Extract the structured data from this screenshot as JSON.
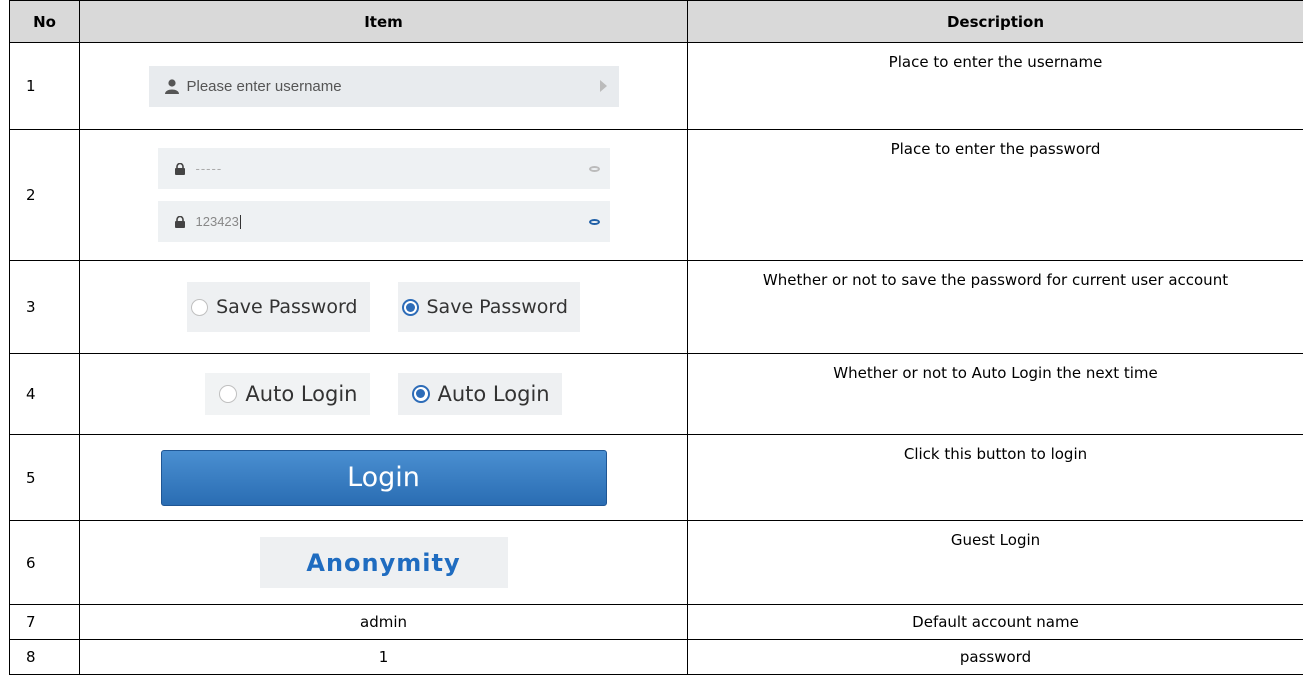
{
  "headers": {
    "no": "No",
    "item": "Item",
    "description": "Description"
  },
  "rows": [
    {
      "no": "1",
      "username_placeholder": "Please enter username",
      "description": "Place to enter the username"
    },
    {
      "no": "2",
      "password_masked": "-----",
      "password_plain": "123423",
      "description": "Place to enter the password"
    },
    {
      "no": "3",
      "label_unchecked": "Save Password",
      "label_checked": "Save Password",
      "description": "Whether or not to save the password for current user account"
    },
    {
      "no": "4",
      "label_unchecked": "Auto Login",
      "label_checked": "Auto Login",
      "description": "Whether or not to Auto Login the next time"
    },
    {
      "no": "5",
      "button_label": "Login",
      "description": "Click this button to login"
    },
    {
      "no": "6",
      "button_label": "Anonymity",
      "description": "Guest Login"
    },
    {
      "no": "7",
      "value": "admin",
      "description": "Default account name"
    },
    {
      "no": "8",
      "value": "1",
      "description": "password"
    }
  ],
  "icons": {
    "username": "user-icon",
    "password": "lock-icon",
    "reveal": "eye-icon",
    "submit": "arrow-right-icon"
  },
  "colors": {
    "header_bg": "#d9d9d9",
    "accent": "#2d6cb8",
    "login_button": "#3a7dc2",
    "anonymity_text": "#1f6cc0"
  }
}
